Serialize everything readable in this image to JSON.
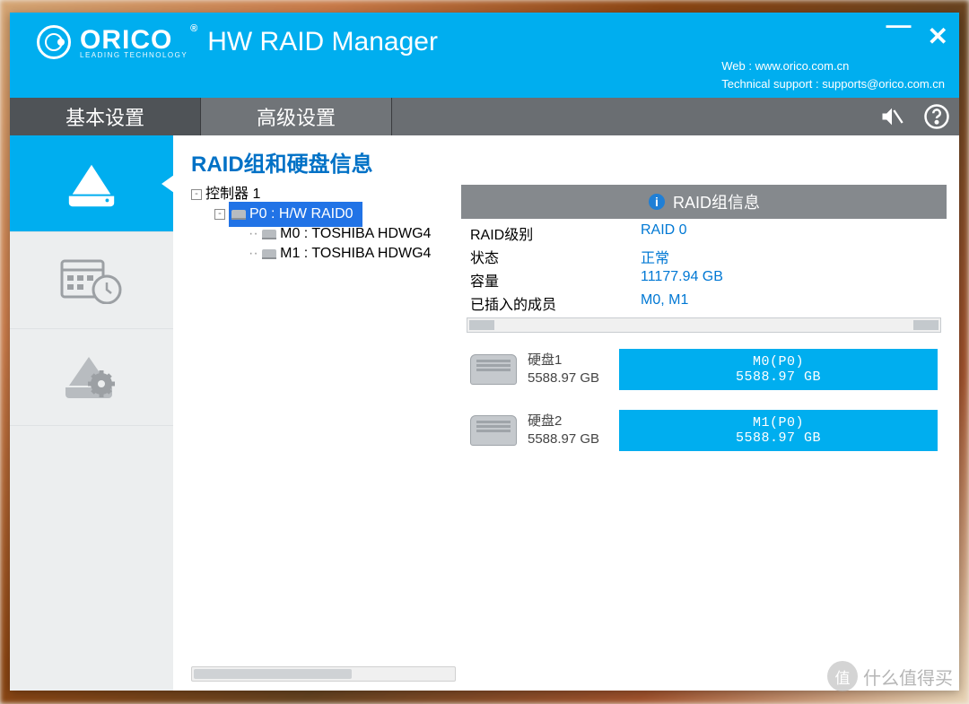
{
  "brand": {
    "name": "ORICO",
    "tagline": "LEADING TECHNOLOGY"
  },
  "app_title": "HW RAID Manager",
  "header_links": {
    "web_label": "Web :",
    "web_url": "www.orico.com.cn",
    "support_label": "Technical support :",
    "support_email": "supports@orico.com.cn"
  },
  "tabs": {
    "basic": "基本设置",
    "advanced": "高级设置"
  },
  "section_title": "RAID组和硬盘信息",
  "tree": {
    "controller": "控制器 1",
    "raid_node": "P0 : H/W RAID0",
    "member0": "M0 : TOSHIBA HDWG4",
    "member1": "M1 : TOSHIBA HDWG4"
  },
  "info_panel": {
    "title": "RAID组信息",
    "kv": [
      {
        "k": "RAID级别",
        "v": "RAID 0"
      },
      {
        "k": "状态",
        "v": "正常"
      },
      {
        "k": "容量",
        "v": "11177.94 GB"
      },
      {
        "k": "已插入的成员",
        "v": "M0, M1"
      }
    ]
  },
  "disks": [
    {
      "label": "硬盘1",
      "size": "5588.97 GB",
      "bar_name": "M0(P0)",
      "bar_size": "5588.97 GB"
    },
    {
      "label": "硬盘2",
      "size": "5588.97 GB",
      "bar_name": "M1(P0)",
      "bar_size": "5588.97 GB"
    }
  ],
  "watermark": {
    "badge": "值",
    "text": "什么值得买"
  }
}
